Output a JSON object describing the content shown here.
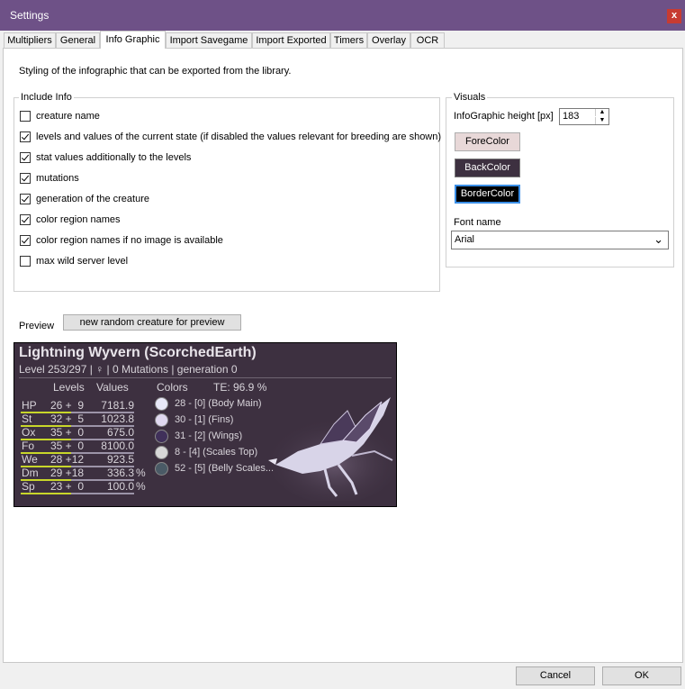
{
  "window": {
    "title": "Settings",
    "close_label": "x"
  },
  "tabs": [
    {
      "label": "Multipliers"
    },
    {
      "label": "General"
    },
    {
      "label": "Info Graphic"
    },
    {
      "label": "Import Savegame"
    },
    {
      "label": "Import Exported"
    },
    {
      "label": "Timers"
    },
    {
      "label": "Overlay"
    },
    {
      "label": "OCR"
    }
  ],
  "active_tab": "Info Graphic",
  "description": "Styling of the infographic that can be exported from the library.",
  "include_info": {
    "legend": "Include Info",
    "items": [
      {
        "label": "creature name",
        "checked": false
      },
      {
        "label": "levels and values of the current state (if disabled the values relevant for breeding are shown)",
        "checked": true
      },
      {
        "label": "stat values additionally to the levels",
        "checked": true
      },
      {
        "label": "mutations",
        "checked": true
      },
      {
        "label": "generation of the creature",
        "checked": true
      },
      {
        "label": "color region names",
        "checked": true
      },
      {
        "label": "color region names if no image is available",
        "checked": true
      },
      {
        "label": "max wild server level",
        "checked": false
      }
    ]
  },
  "visuals": {
    "legend": "Visuals",
    "height_label": "InfoGraphic height [px]",
    "height_value": "183",
    "forecolor_label": "ForeColor",
    "backcolor_label": "BackColor",
    "bordercolor_label": "BorderColor",
    "font_label": "Font name",
    "font_value": "Arial",
    "colors": {
      "forecolor_btn": "#e8d8d8",
      "backcolor_btn": "#3d3040",
      "bordercolor_btn": "#000000"
    }
  },
  "preview": {
    "label": "Preview",
    "random_button": "new random creature for preview",
    "title": "Lightning Wyvern (ScorchedEarth)",
    "subtitle": "Level 253/297 | ♀ | 0 Mutations | generation 0",
    "header_levels": "Levels",
    "header_values": "Values",
    "header_colors": "Colors",
    "header_te": "TE: 96.9 %",
    "stats": [
      {
        "name": "HP",
        "levels": "26 +  9",
        "value": "7181.9",
        "pct": ""
      },
      {
        "name": "St",
        "levels": "32 +  5",
        "value": "1023.8",
        "pct": ""
      },
      {
        "name": "Ox",
        "levels": "35 +  0",
        "value": "675.0",
        "pct": ""
      },
      {
        "name": "Fo",
        "levels": "35 +  0",
        "value": "8100.0",
        "pct": ""
      },
      {
        "name": "We",
        "levels": "28 +12",
        "value": "923.5",
        "pct": ""
      },
      {
        "name": "Dm",
        "levels": "29 +18",
        "value": "336.3",
        "pct": "%"
      },
      {
        "name": "Sp",
        "levels": "23 +  0",
        "value": "100.0",
        "pct": "%"
      }
    ],
    "stat_bar_fill": [
      0.55,
      0.65,
      0.7,
      0.7,
      0.55,
      0.6,
      0.45
    ],
    "colors": [
      {
        "text": "28 - [0] (Body Main)",
        "hex": "#e8e8f8"
      },
      {
        "text": "30 - [1] (Fins)",
        "hex": "#e0d8f0"
      },
      {
        "text": "31 - [2] (Wings)",
        "hex": "#40305a"
      },
      {
        "text": "8 - [4] (Scales Top)",
        "hex": "#d8d8d8"
      },
      {
        "text": "52 - [5] (Belly Scales...",
        "hex": "#4a5a66"
      }
    ],
    "background": "#3d3040"
  },
  "footer": {
    "cancel_label": "Cancel",
    "ok_label": "OK"
  }
}
